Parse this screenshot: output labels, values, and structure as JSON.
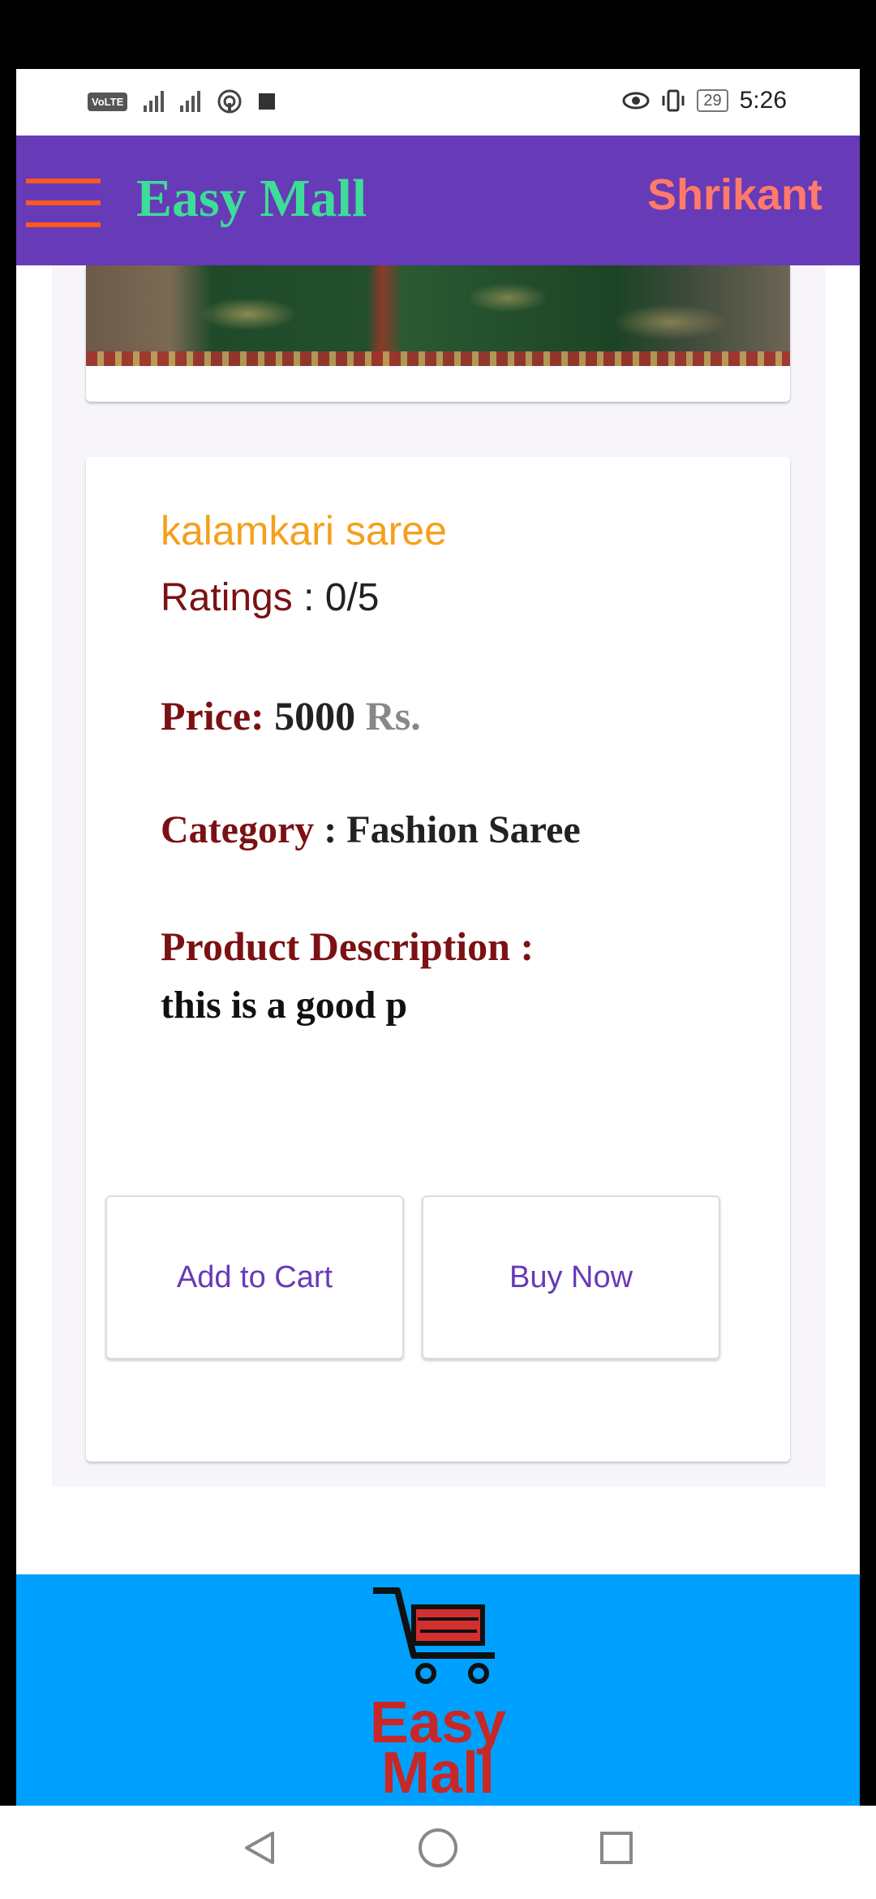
{
  "status_bar": {
    "volte": "VoLTE",
    "battery": "29",
    "time": "5:26"
  },
  "header": {
    "brand": "Easy Mall",
    "user_name": "Shrikant"
  },
  "product": {
    "name": "kalamkari saree",
    "ratings_label": "Ratings",
    "ratings_sep": " : ",
    "ratings_value": "0/5",
    "price_label": "Price:",
    "price_value": "5000",
    "price_currency": "Rs.",
    "category_label": "Category",
    "category_sep": " : ",
    "category_value": "Fashion Saree",
    "description_label": "Product Description :",
    "description_text": "this is a good p"
  },
  "actions": {
    "add_to_cart": "Add to Cart",
    "buy_now": "Buy Now"
  },
  "footer": {
    "logo_line1": "Easy",
    "logo_line2": "Mall"
  },
  "colors": {
    "header_bg": "#673ab7",
    "brand": "#3ddc97",
    "user": "#ff7a6b",
    "accent": "#ff5722",
    "label": "#7b1113",
    "product_name": "#f4a01c",
    "footer_bg": "#00a0ff"
  }
}
